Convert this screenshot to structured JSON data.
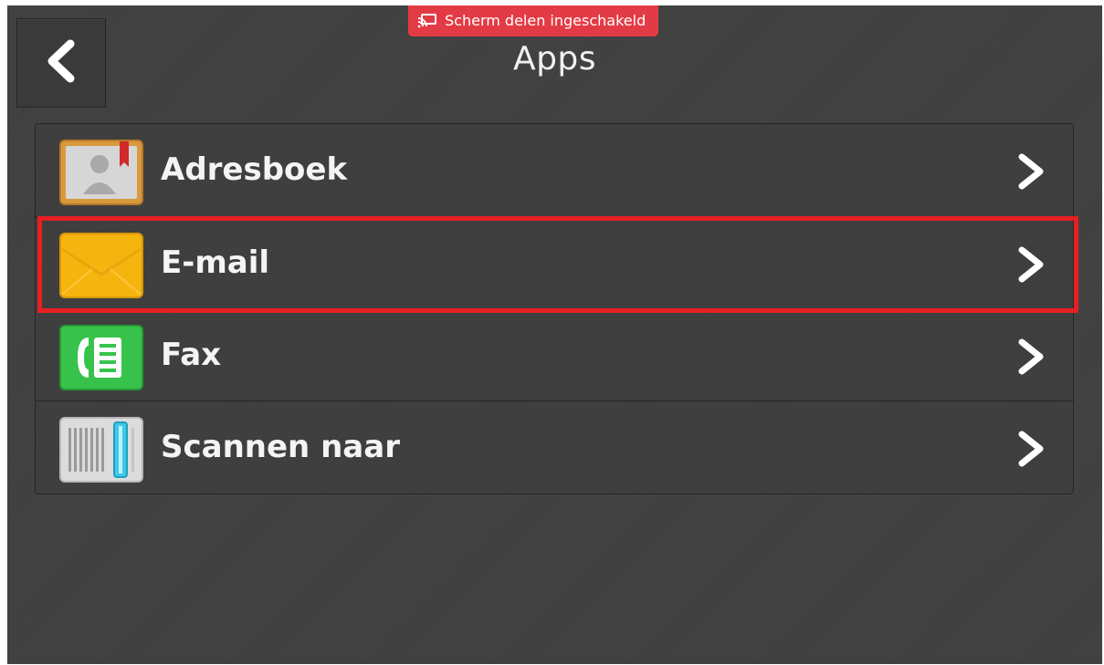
{
  "banner": {
    "icon": "screen-share-icon",
    "text": "Scherm delen ingeschakeld",
    "color": "#e33b45"
  },
  "header": {
    "back_icon": "chevron-left-icon",
    "title": "Apps"
  },
  "apps": [
    {
      "label": "Adresboek",
      "icon": "address-book-icon"
    },
    {
      "label": "E-mail",
      "icon": "email-envelope-icon",
      "highlighted": true
    },
    {
      "label": "Fax",
      "icon": "fax-icon"
    },
    {
      "label": "Scannen naar",
      "icon": "scan-to-icon"
    }
  ],
  "colors": {
    "background": "#3f3f3f",
    "highlight": "#e61f23",
    "text": "#f4f4f4"
  }
}
